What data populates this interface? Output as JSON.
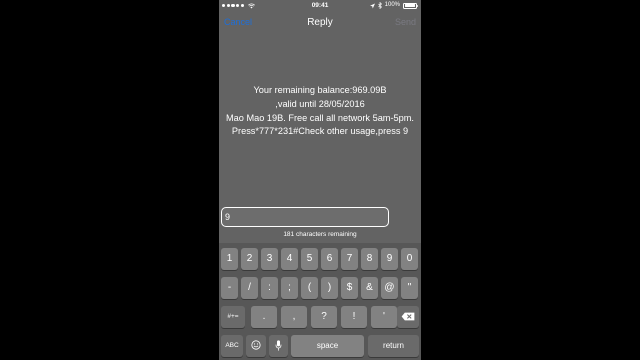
{
  "status_bar": {
    "time": "09:41",
    "battery_text": "100%",
    "icons": [
      "signal-dots-icon",
      "wifi-icon",
      "location-icon",
      "bluetooth-icon",
      "battery-icon"
    ]
  },
  "nav": {
    "left_label": "Cancel",
    "title": "Reply",
    "right_label": "Send"
  },
  "message": {
    "lines": [
      "Your remaining balance:969.09B",
      ",valid until 28/05/2016",
      "Mao Mao 19B. Free call all network 5am-5pm.",
      "Press*777*231#Check other usage,press 9"
    ]
  },
  "reply": {
    "value": "9"
  },
  "counter": "181 characters remaining",
  "keyboard": {
    "row1": [
      "1",
      "2",
      "3",
      "4",
      "5",
      "6",
      "7",
      "8",
      "9",
      "0"
    ],
    "row2": [
      "-",
      "/",
      ":",
      ";",
      "(",
      ")",
      "$",
      "&",
      "@",
      "\""
    ],
    "row3": [
      ".",
      ",",
      "?",
      "!",
      "'"
    ],
    "shift_label": "#+=",
    "abc_label": "ABC",
    "space_label": "space",
    "return_label": "return"
  },
  "colors": {
    "accent": "#1f6fd8",
    "background": "#636363",
    "key": "#828282"
  }
}
